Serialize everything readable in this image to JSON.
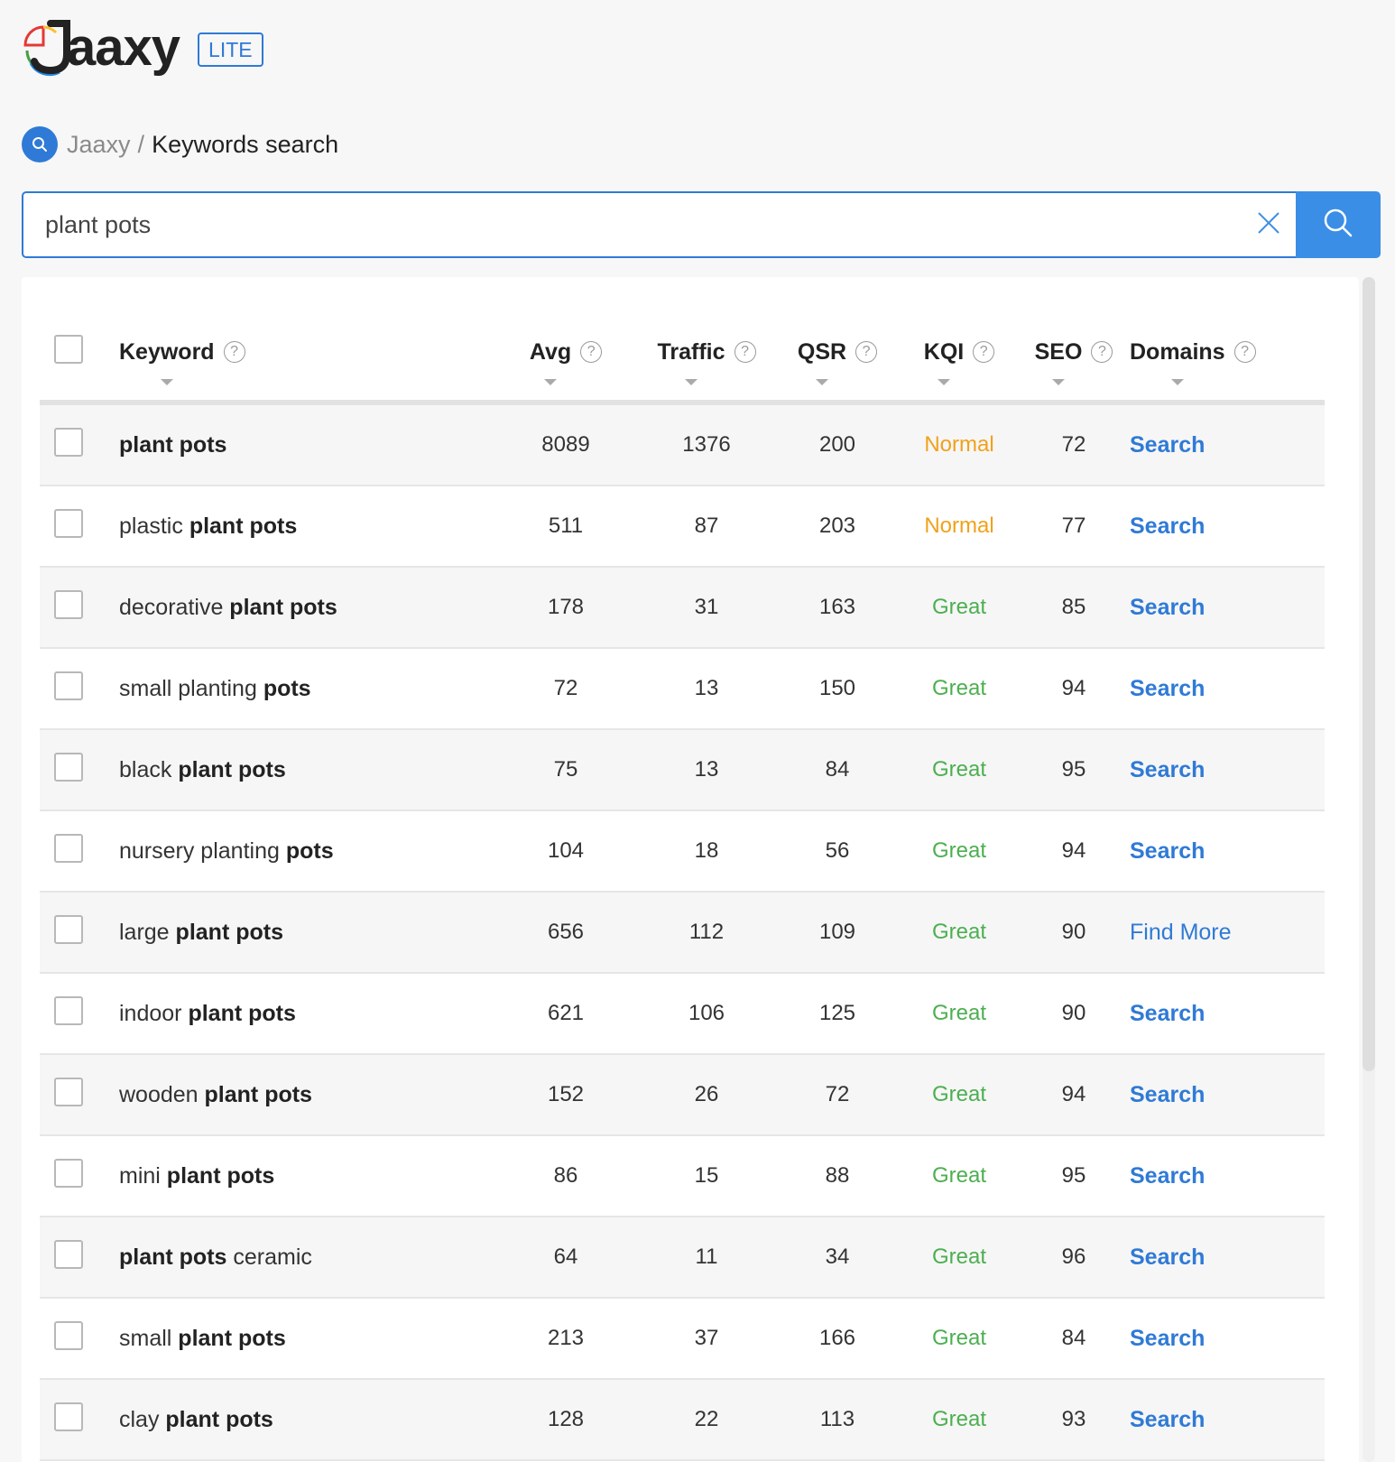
{
  "brand": {
    "name": "Jaaxy",
    "logo_text": "aaxy",
    "badge": "LITE"
  },
  "breadcrumb": {
    "root": "Jaaxy",
    "separator": "/",
    "current": "Keywords search"
  },
  "search": {
    "value": "plant pots"
  },
  "table": {
    "columns": [
      "Keyword",
      "Avg",
      "Traffic",
      "QSR",
      "KQI",
      "SEO",
      "Domains"
    ],
    "help_symbol": "?",
    "rows": [
      {
        "kw_pre": "",
        "kw_bold": "plant pots",
        "kw_post": "",
        "avg": "8089",
        "traffic": "1376",
        "qsr": "200",
        "kqi": "Normal",
        "seo": "72",
        "domains": "Search"
      },
      {
        "kw_pre": "plastic ",
        "kw_bold": "plant pots",
        "kw_post": "",
        "avg": "511",
        "traffic": "87",
        "qsr": "203",
        "kqi": "Normal",
        "seo": "77",
        "domains": "Search"
      },
      {
        "kw_pre": "decorative ",
        "kw_bold": "plant pots",
        "kw_post": "",
        "avg": "178",
        "traffic": "31",
        "qsr": "163",
        "kqi": "Great",
        "seo": "85",
        "domains": "Search"
      },
      {
        "kw_pre": "small planting ",
        "kw_bold": "pots",
        "kw_post": "",
        "avg": "72",
        "traffic": "13",
        "qsr": "150",
        "kqi": "Great",
        "seo": "94",
        "domains": "Search"
      },
      {
        "kw_pre": "black ",
        "kw_bold": "plant pots",
        "kw_post": "",
        "avg": "75",
        "traffic": "13",
        "qsr": "84",
        "kqi": "Great",
        "seo": "95",
        "domains": "Search"
      },
      {
        "kw_pre": "nursery planting ",
        "kw_bold": "pots",
        "kw_post": "",
        "avg": "104",
        "traffic": "18",
        "qsr": "56",
        "kqi": "Great",
        "seo": "94",
        "domains": "Search"
      },
      {
        "kw_pre": "large ",
        "kw_bold": "plant pots",
        "kw_post": "",
        "avg": "656",
        "traffic": "112",
        "qsr": "109",
        "kqi": "Great",
        "seo": "90",
        "domains": "Find More"
      },
      {
        "kw_pre": "indoor ",
        "kw_bold": "plant pots",
        "kw_post": "",
        "avg": "621",
        "traffic": "106",
        "qsr": "125",
        "kqi": "Great",
        "seo": "90",
        "domains": "Search"
      },
      {
        "kw_pre": "wooden ",
        "kw_bold": "plant pots",
        "kw_post": "",
        "avg": "152",
        "traffic": "26",
        "qsr": "72",
        "kqi": "Great",
        "seo": "94",
        "domains": "Search"
      },
      {
        "kw_pre": "mini ",
        "kw_bold": "plant pots",
        "kw_post": "",
        "avg": "86",
        "traffic": "15",
        "qsr": "88",
        "kqi": "Great",
        "seo": "95",
        "domains": "Search"
      },
      {
        "kw_pre": "",
        "kw_bold": "plant pots",
        "kw_post": " ceramic",
        "avg": "64",
        "traffic": "11",
        "qsr": "34",
        "kqi": "Great",
        "seo": "96",
        "domains": "Search"
      },
      {
        "kw_pre": "small ",
        "kw_bold": "plant pots",
        "kw_post": "",
        "avg": "213",
        "traffic": "37",
        "qsr": "166",
        "kqi": "Great",
        "seo": "84",
        "domains": "Search"
      },
      {
        "kw_pre": "clay ",
        "kw_bold": "plant pots",
        "kw_post": "",
        "avg": "128",
        "traffic": "22",
        "qsr": "113",
        "kqi": "Great",
        "seo": "93",
        "domains": "Search"
      }
    ]
  },
  "colors": {
    "accent": "#2f7ad6",
    "kqi_normal": "#f1a11b",
    "kqi_great": "#4caf50"
  },
  "icons": {
    "logo": "jaaxy-logo-icon",
    "breadcrumb": "search-icon",
    "clear": "close-icon",
    "submit": "search-icon",
    "help": "question-circle-icon",
    "sort": "caret-down-icon"
  }
}
